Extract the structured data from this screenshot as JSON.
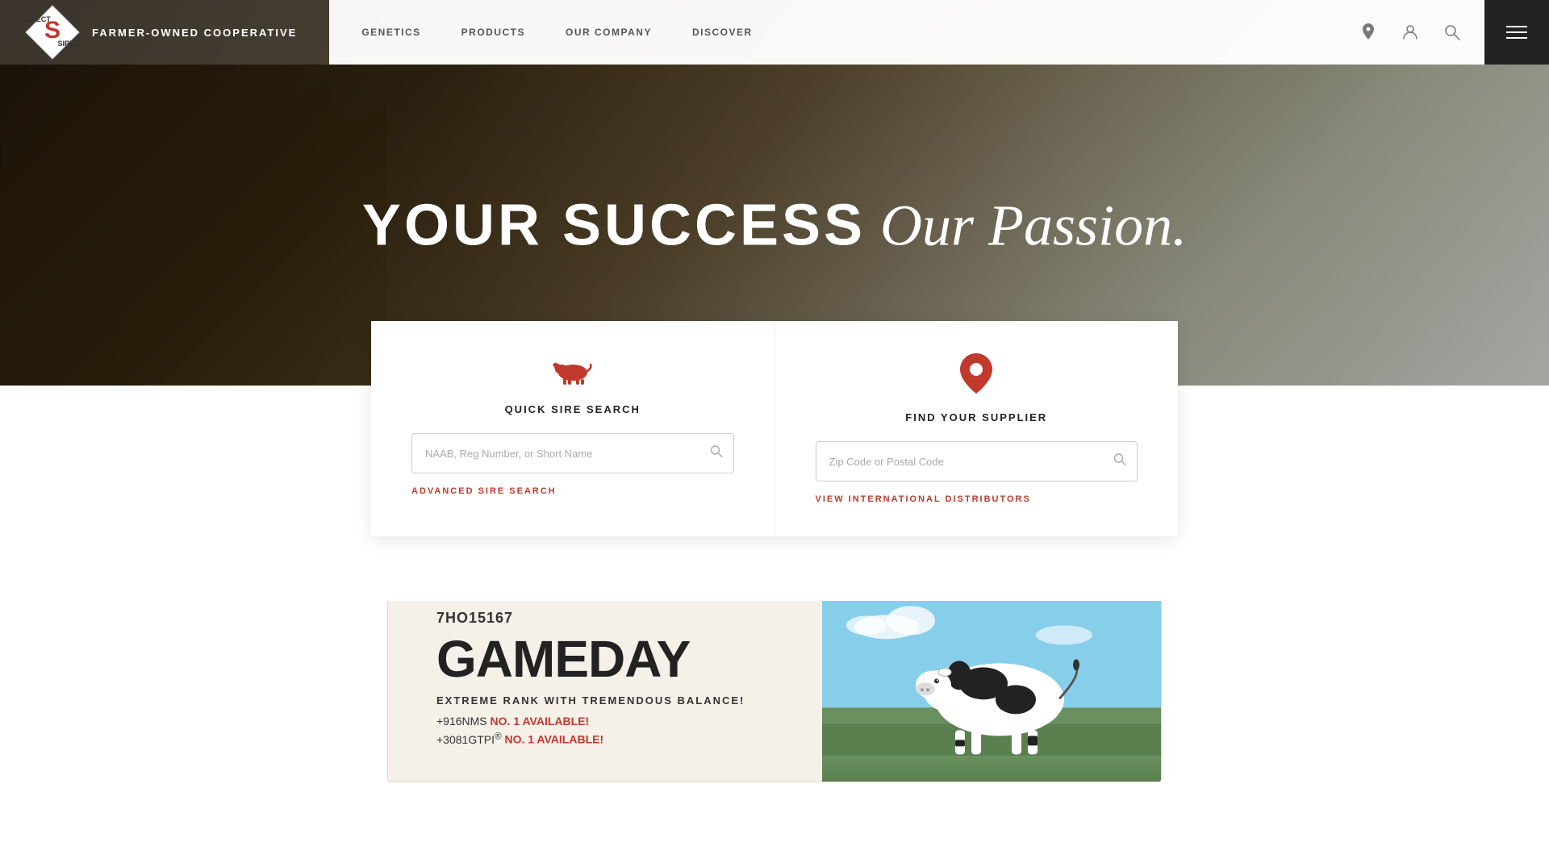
{
  "brand": {
    "company": "FARMER-OWNED COOPERATIVE",
    "logo_alt": "Select Sires logo"
  },
  "nav": {
    "links": [
      {
        "id": "genetics",
        "label": "GENETICS"
      },
      {
        "id": "products",
        "label": "PRODUCTS"
      },
      {
        "id": "our-company",
        "label": "OUR COMPANY"
      },
      {
        "id": "discover",
        "label": "DISCOVER"
      }
    ],
    "icons": {
      "location": "location-icon",
      "account": "account-icon",
      "search": "search-icon",
      "menu": "menu-icon"
    }
  },
  "hero": {
    "headline_part1": "YOUR SUCCESS",
    "headline_part2": "Our Passion."
  },
  "quick_sire_search": {
    "title": "QUICK SIRE SEARCH",
    "placeholder": "NAAB, Reg Number, or Short Name",
    "link_label": "ADVANCED SIRE SEARCH"
  },
  "find_supplier": {
    "title": "FIND YOUR SUPPLIER",
    "placeholder": "Zip Code or Postal Code",
    "link_label": "VIEW INTERNATIONAL DISTRIBUTORS"
  },
  "feature_bull": {
    "id": "7HO15167",
    "name": "GAMEDAY",
    "tagline": "EXTREME RANK WITH TREMENDOUS BALANCE!",
    "stats": [
      {
        "label": "+916NMS",
        "highlight": "NO. 1 AVAILABLE!"
      },
      {
        "label": "+3081GTPI®",
        "highlight": "NO. 1 AVAILABLE!"
      }
    ]
  },
  "colors": {
    "accent": "#c0392b",
    "dark": "#222222",
    "light_bg": "#f5f0e8",
    "text": "#333333"
  }
}
